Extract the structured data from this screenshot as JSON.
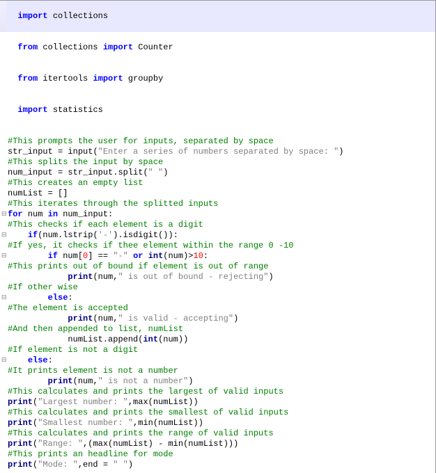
{
  "gutter": {
    "fold": "⊟",
    "blank": " "
  },
  "tok": {
    "import": "import",
    "from": "from",
    "for": "for",
    "in": "in",
    "if": "if",
    "else": "else",
    "or": "or",
    "print": "print",
    "int": "int",
    "max": "max",
    "min": "min",
    "input": "input",
    "collections": "collections",
    "Counter": "Counter",
    "itertools": "itertools",
    "groupby": "groupby",
    "statistics": "statistics",
    "str_input": "str_input",
    "num_input": "num_input",
    "numList": "numList",
    "num": "num",
    "eq": " = ",
    "eqeq": " == ",
    "dot": ".",
    "comma": ",",
    "colon": ":",
    "lpar": "(",
    "rpar": ")",
    "lbrk": "[",
    "rbrk": "]",
    "gt": ">",
    "minus": " - ",
    "star": "*",
    "sp4": "    ",
    "sp8": "        ",
    "sp12": "            ",
    "sp1": " "
  },
  "str": {
    "prompt": "\"Enter a series of numbers separated by space: \"",
    "space": "\" \"",
    "dashq": "'-'",
    "dash": "\"-\"",
    "oob": "\" is out of bound - rejecting\"",
    "valid": "\" is valid - accepting\"",
    "notnum": "\" is not a number\"",
    "largest": "\"Largest number: \"",
    "smallest": "\"Smallest number: \"",
    "range": "\"Range: \"",
    "mode": "\"Mode: \"",
    "blank": "\" \"",
    "end": "end"
  },
  "num": {
    "zero": "0",
    "ten": "10"
  },
  "cmt": {
    "c1": "#This prompts the user for inputs, separated by space",
    "c2": "#This splits the input by space",
    "c3": "#This creates an empty list",
    "c4": "#This iterates through the splitted inputs",
    "c5": "#This checks if each element is a digit",
    "c6": "#If yes, it checks if thee element within the range 0 -10",
    "c7": "#This prints out of bound if element is out of range",
    "c8": "#If other wise",
    "c9": "#The element is accepted",
    "c10": "#And then appended to list, numList",
    "c11": "#If element is not a digit",
    "c12": "#It prints element is not a number",
    "c13": "#This calculates and prints the largest of valid inputs",
    "c14": "#This calculates and prints the smallest of valid inputs",
    "c15": "#This calculates and prints the range of valid inputs",
    "c16": "#This prints an headline for mode"
  },
  "fn": {
    "lstrip": "lstrip",
    "isdigit": "isdigit",
    "split": "split",
    "append": "append"
  }
}
